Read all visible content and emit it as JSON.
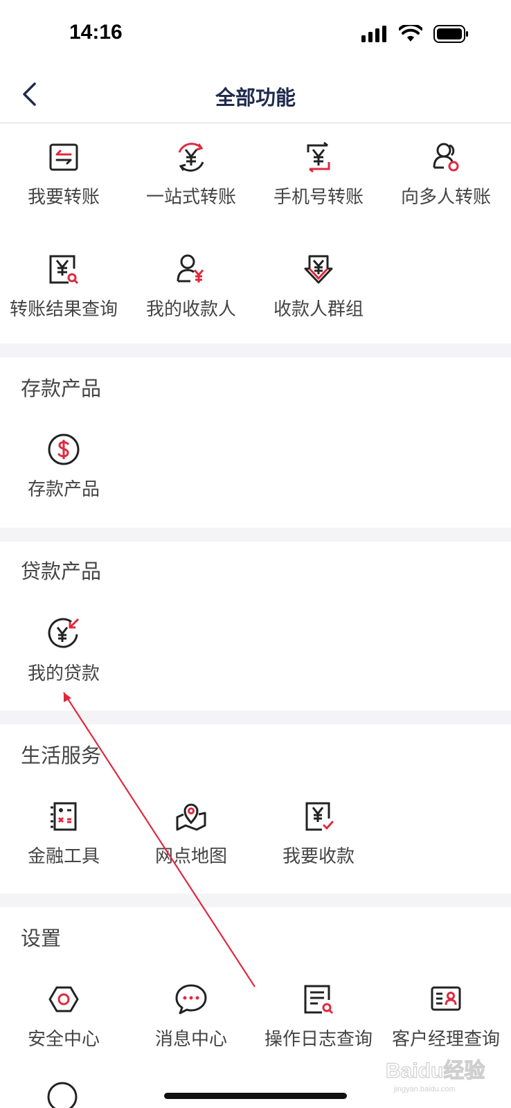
{
  "status_bar": {
    "time": "14:16"
  },
  "header": {
    "title": "全部功能"
  },
  "transfer": {
    "items": [
      {
        "label": "我要转账",
        "icon": "transfer-icon"
      },
      {
        "label": "一站式转账",
        "icon": "one-stop-transfer-icon"
      },
      {
        "label": "手机号转账",
        "icon": "phone-transfer-icon"
      },
      {
        "label": "向多人转账",
        "icon": "multi-transfer-icon"
      },
      {
        "label": "转账结果查询",
        "icon": "transfer-result-search-icon"
      },
      {
        "label": "我的收款人",
        "icon": "payee-icon"
      },
      {
        "label": "收款人群组",
        "icon": "payee-group-icon"
      }
    ]
  },
  "deposit": {
    "title": "存款产品",
    "items": [
      {
        "label": "存款产品",
        "icon": "dollar-circle-icon"
      }
    ]
  },
  "loan": {
    "title": "贷款产品",
    "items": [
      {
        "label": "我的贷款",
        "icon": "loan-icon"
      }
    ]
  },
  "life": {
    "title": "生活服务",
    "items": [
      {
        "label": "金融工具",
        "icon": "calculator-icon"
      },
      {
        "label": "网点地图",
        "icon": "map-pin-icon"
      },
      {
        "label": "我要收款",
        "icon": "receive-payment-icon"
      }
    ]
  },
  "settings": {
    "title": "设置",
    "items": [
      {
        "label": "安全中心",
        "icon": "security-center-icon"
      },
      {
        "label": "消息中心",
        "icon": "message-center-icon"
      },
      {
        "label": "操作日志查询",
        "icon": "operation-log-icon"
      },
      {
        "label": "客户经理查询",
        "icon": "account-manager-icon"
      }
    ]
  },
  "watermark": {
    "text": "Baidu经验",
    "subtext": "jingyan.baidu.com"
  },
  "colors": {
    "accent": "#e0283c",
    "icon_dark": "#222222",
    "title_navy": "#1f2a4d",
    "divider_band": "#f4f4f6"
  }
}
